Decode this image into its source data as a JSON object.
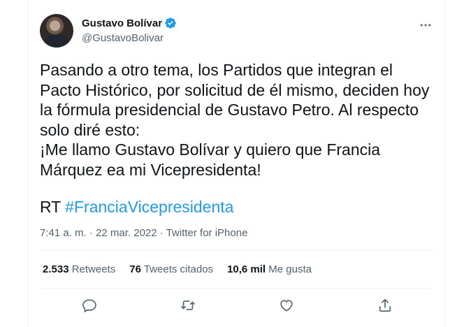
{
  "author": {
    "display_name": "Gustavo Bolívar",
    "handle": "@GustavoBolivar",
    "verified": true,
    "avatar_icon": "profile-photo"
  },
  "tweet": {
    "text": "Pasando a otro tema, los Partidos que integran el\nPacto Histórico, por solicitud de él mismo, deciden hoy\nla fórmula presidencial de Gustavo Petro. Al respecto\nsolo diré esto:\n¡Me llamo Gustavo Bolívar y quiero que Francia\nMárquez ea mi Vicepresidenta!",
    "rt_prefix": "RT",
    "hashtag": "#FranciaVicepresidenta"
  },
  "meta": {
    "time": "7:41 a. m.",
    "separator": "·",
    "date": "22 mar. 2022",
    "source": "Twitter for iPhone"
  },
  "stats": {
    "retweets_count": "2.533",
    "retweets_label": "Retweets",
    "quotes_count": "76",
    "quotes_label": "Tweets citados",
    "likes_count": "10,6 mil",
    "likes_label": "Me gusta"
  },
  "colors": {
    "accent": "#1d9bf0",
    "text": "#0f1419",
    "muted": "#536471",
    "border": "#eff3f4"
  },
  "icons": [
    "verified-badge-icon",
    "more-options-icon",
    "reply-icon",
    "retweet-icon",
    "like-icon",
    "share-icon"
  ]
}
